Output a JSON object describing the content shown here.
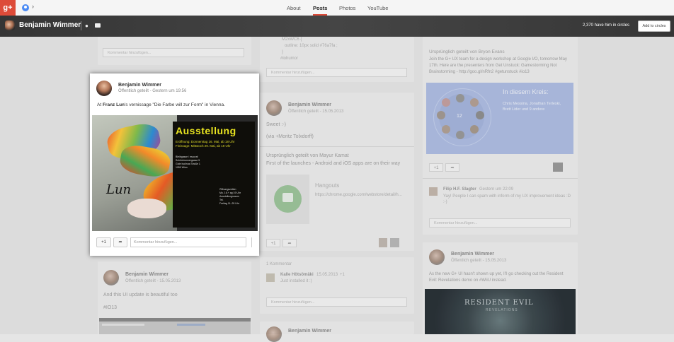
{
  "topbar": {
    "logo": "g+",
    "chevron": "›",
    "tabs": [
      {
        "label": "About",
        "active": false
      },
      {
        "label": "Posts",
        "active": true
      },
      {
        "label": "Photos",
        "active": false
      },
      {
        "label": "YouTube",
        "active": false
      }
    ]
  },
  "profile": {
    "name": "Benjamin Wimmer",
    "circles_count": "2,370 have him in circles",
    "add_button": "Add to circles"
  },
  "focused_post": {
    "author": "Benjamin Wimmer",
    "visibility": "Öffentlich geteilt",
    "time": "Gestern um 19:56",
    "text_prefix": "At ",
    "text_link": "Franz Lun",
    "text_suffix": "'s vernissage \"Die Farbe will zur Form\" in Vienna.",
    "poster_title": "Ausstellung",
    "poster_dates": [
      "Eröffnung: Donnerstag 16. Mai, ab 18 Uhr",
      "Finissage: Mittwoch 29. Mai, ab 19 Uhr"
    ],
    "poster_address": [
      "Bleibgasse / escoraf",
      "Schönbrunnergasse 5",
      "Gute Isolinus Straße 1",
      "1050 Wien"
    ],
    "poster_info": [
      "Öffnungszeiten",
      "Mo. 16.+ ag 19 Uhr",
      "Ausstellungsraum",
      "Tel.",
      "Freitag 11–20 Uhr"
    ],
    "signature": "Lun",
    "plus_one": "+1",
    "comment_placeholder": "Kommentar hinzufügen..."
  },
  "col1": {
    "comment_placeholder": "Kommentar hinzufügen...",
    "post2_author": "Benjamin Wimmer",
    "post2_meta": "Öffentlich geteilt  -  15.05.2013",
    "post2_text": "And this UI update is beautiful too",
    "post2_tag": "#IO13"
  },
  "col2": {
    "code_line1": "M2xWC6 {",
    "code_line2": "outline: 10px solid #76a7fa ;",
    "code_line3": "}",
    "code_tag": "#iohumor",
    "comment_placeholder": "Kommentar hinzufügen...",
    "post_author": "Benjamin Wimmer",
    "post_meta": "Öffentlich geteilt  -  15.05.2013",
    "post_text1": "Sweet :-)",
    "post_text2": "(via +Moritz Tolxdorff)",
    "reshare": "Ursprünglich geteilt von Mayur Kamat",
    "reshare_text": "First of the launches - Android and iOS apps are on their way",
    "link_title": "Hangouts",
    "link_url": "https://chrome.google.com/webstore/detail/h...",
    "comments_count": "1 Kommentar",
    "commenter": "Kalle Hötsömäki",
    "comment_date": "15.05.2013",
    "comment_plus": "+1",
    "comment_text": "Just installed it :)",
    "comment2_placeholder": "Kommentar hinzufügen...",
    "post3_author": "Benjamin Wimmer",
    "post3_meta": "Öffentlich geteilt  -  15.05.2013",
    "plus_one": "+1"
  },
  "col3": {
    "reshare": "Ursprünglich geteilt von Bryon Evans",
    "text": "Join the G+ UX team for a design workshop at Google I/O, tomorrow May 17th. Here are the presenters from Get Unstuck: Gamestorming Not Brainstorming - http://goo.gl/nRfn2 #getunstuck #io13",
    "circle_title": "In diesem Kreis:",
    "circle_count": "12",
    "circle_names": "Chris Messina, Jonathan Terleski, Brett Lider und 9 andere",
    "plus_one": "+1",
    "commenter": "Filip H.F. Slagter",
    "comment_date": "Gestern um 22:09",
    "comment_text": "Yay! People I can spam with inform of my UX improvement ideas :D :-)",
    "comment_placeholder": "Kommentar hinzufügen...",
    "post2_author": "Benjamin Wimmer",
    "post2_meta": "Öffentlich geteilt  -  15.05.2013",
    "post2_text": "As the new G+ UI hasn't shown up yet, I'll go checking out the Resident Evil: Revelations demo on #WiiU instead.",
    "game_title": "RESIDENT EVIL",
    "game_subtitle": "REVELATIONS"
  }
}
